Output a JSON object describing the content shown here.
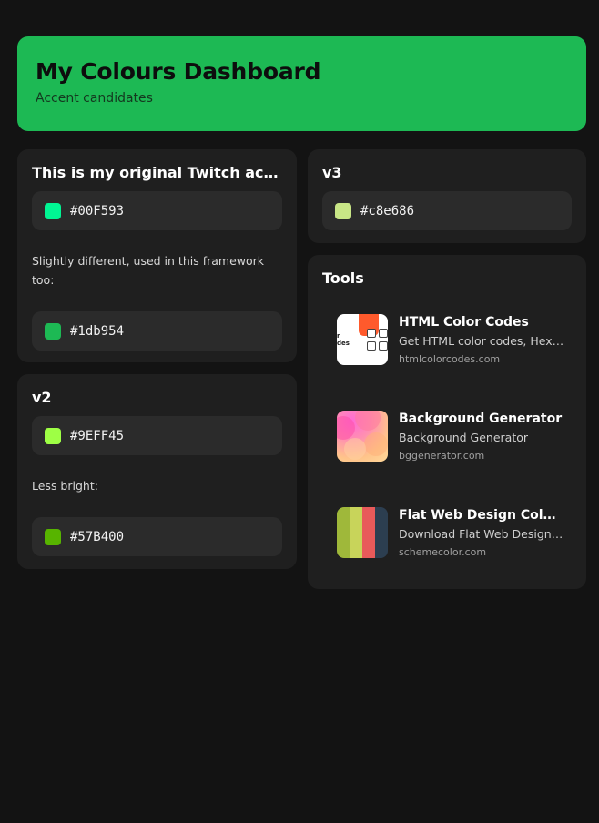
{
  "header": {
    "title": "My Colours Dashboard",
    "subtitle": "Accent candidates"
  },
  "cards": {
    "original": {
      "title": "This is my original Twitch accent colour",
      "color1": {
        "hex": "#00F593",
        "swatch": "#00F593"
      },
      "note": "Slightly different, used in this framework too:",
      "color2": {
        "hex": "#1db954",
        "swatch": "#1db954"
      }
    },
    "v2": {
      "title": "v2",
      "color1": {
        "hex": "#9EFF45",
        "swatch": "#9EFF45"
      },
      "note": "Less bright:",
      "color2": {
        "hex": "#57B400",
        "swatch": "#57B400"
      }
    },
    "v3": {
      "title": "v3",
      "color1": {
        "hex": "#c8e686",
        "swatch": "#c8e686"
      }
    },
    "tools": {
      "title": "Tools",
      "items": [
        {
          "name": "HTML Color Codes",
          "description": "Get HTML color codes, Hex color codes, RGB and HSL values",
          "domain": "htmlcolorcodes.com",
          "icon": "htmlcolorcodes-thumbnail"
        },
        {
          "name": "Background Generator",
          "description": "Background Generator",
          "domain": "bggenerator.com",
          "icon": "bggenerator-thumbnail"
        },
        {
          "name": "Flat Web Design Color Scheme",
          "description": "Download Flat Web Design Color Scheme",
          "domain": "schemecolor.com",
          "icon": "schemecolor-thumbnail"
        }
      ]
    }
  },
  "colors": {
    "background": "#131313",
    "card": "#1f1f1f",
    "swatch_row": "#2b2b2b",
    "accent": "#1db954",
    "flat_scheme": [
      "#9fb83a",
      "#c8d45a",
      "#e85a5a",
      "#2c3e50"
    ]
  }
}
